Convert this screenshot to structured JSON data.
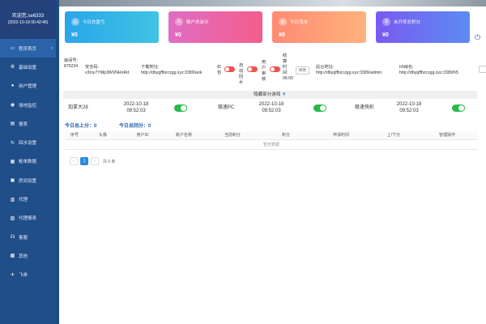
{
  "sidebar": {
    "welcome": "欢迎您,se6333",
    "time": "(2022-10-18 00:42:46)",
    "items": [
      {
        "label": "程序首页",
        "icon": "monitor-icon"
      },
      {
        "label": "基础设置",
        "icon": "settings-icon"
      },
      {
        "label": "用户管理",
        "icon": "user-icon"
      },
      {
        "label": "场地监控",
        "icon": "eye-icon"
      },
      {
        "label": "报表",
        "icon": "chart-icon"
      },
      {
        "label": "回水设置",
        "icon": "refresh-icon"
      },
      {
        "label": "帐单数据",
        "icon": "bill-icon"
      },
      {
        "label": "房间设置",
        "icon": "room-icon"
      },
      {
        "label": "代理",
        "icon": "agent-icon"
      },
      {
        "label": "代理报表",
        "icon": "report-icon"
      },
      {
        "label": "客服",
        "icon": "headset-icon"
      },
      {
        "label": "其他",
        "icon": "grid-icon"
      },
      {
        "label": "飞单",
        "icon": "plane-icon"
      }
    ]
  },
  "cards": [
    {
      "title": "今日总盈亏",
      "value": "¥0",
      "icon": "headset-icon"
    },
    {
      "title": "账户总余分",
      "value": "¥0",
      "icon": "database-icon"
    },
    {
      "title": "今日流水",
      "value": "¥0",
      "icon": "gear-icon"
    },
    {
      "title": "未开奖总积分",
      "value": "¥0",
      "icon": "coin-icon"
    }
  ],
  "info": {
    "room_no_label": "房间号:",
    "room_no": "875234",
    "secure_label": "安全码:",
    "secure_code": "v3my7YMp3WXNHnRd",
    "download_label": "下载地址:",
    "download_url": "http://dbygffbzczgg.xyz:3389/ank",
    "red_label": "红包",
    "auto_return_label": "自动回水",
    "user_audit_label": "用户审核",
    "settle_time_label": "结算时间:",
    "settle_time": "06:00",
    "edit_label": "修改",
    "backend_label": "后台地址:",
    "backend_url": "http://dbygffbzczgg.xyz:3389/admin",
    "h5_label": "h5域名:",
    "h5_url": "http://dbygffbzczgg.xyz:3389/h5"
  },
  "hidden_games_label": "隐藏部分游戏",
  "games": [
    {
      "name": "加拿大28",
      "date": "2022-10-18",
      "time": "09:52:03"
    },
    {
      "name": "极速PC",
      "date": "2022-10-18",
      "time": "09:52:03"
    },
    {
      "name": "极速快彩",
      "date": "2022-10-18",
      "time": "09:52:03"
    }
  ],
  "totals": {
    "up": "今日总上分：0",
    "down": "今日总回分：0"
  },
  "table": {
    "columns": [
      "序号",
      "头像",
      "用户ID",
      "账户名称",
      "当前积分",
      "积分",
      "申请时间",
      "上/下分",
      "管理操作"
    ],
    "empty_text": "暂无数据"
  },
  "pager": {
    "prev": "‹",
    "current": "1",
    "next": "›",
    "total": "共 0 条"
  },
  "colors": {
    "sidebar": "#1f4e89",
    "accent": "#2a8ae0",
    "toggle_on": "#27b94a",
    "toggle_off": "#ef5350"
  }
}
